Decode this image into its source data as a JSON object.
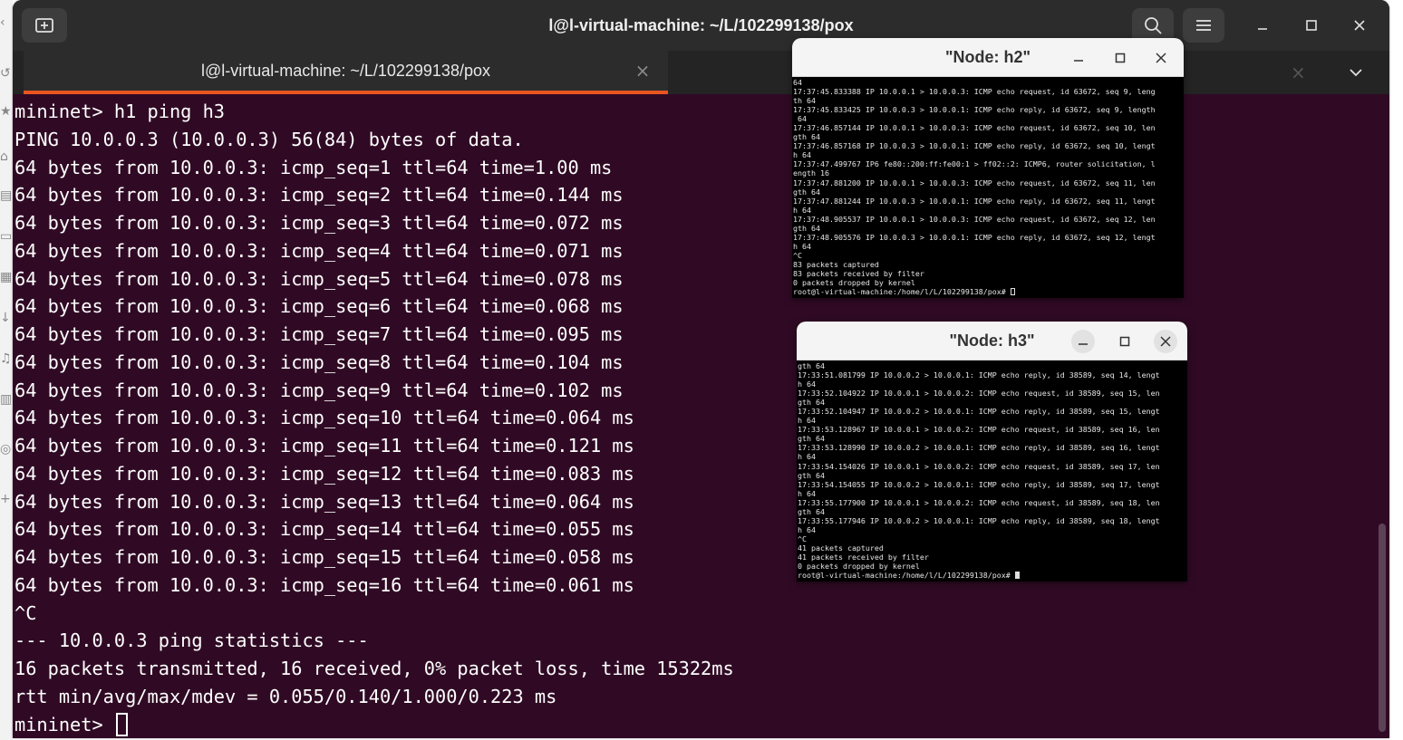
{
  "main_window": {
    "title": "l@l-virtual-machine: ~/L/102299138/pox",
    "tab_label": "l@l-virtual-machine: ~/L/102299138/pox",
    "terminal_lines": [
      "mininet> h1 ping h3",
      "PING 10.0.0.3 (10.0.0.3) 56(84) bytes of data.",
      "64 bytes from 10.0.0.3: icmp_seq=1 ttl=64 time=1.00 ms",
      "64 bytes from 10.0.0.3: icmp_seq=2 ttl=64 time=0.144 ms",
      "64 bytes from 10.0.0.3: icmp_seq=3 ttl=64 time=0.072 ms",
      "64 bytes from 10.0.0.3: icmp_seq=4 ttl=64 time=0.071 ms",
      "64 bytes from 10.0.0.3: icmp_seq=5 ttl=64 time=0.078 ms",
      "64 bytes from 10.0.0.3: icmp_seq=6 ttl=64 time=0.068 ms",
      "64 bytes from 10.0.0.3: icmp_seq=7 ttl=64 time=0.095 ms",
      "64 bytes from 10.0.0.3: icmp_seq=8 ttl=64 time=0.104 ms",
      "64 bytes from 10.0.0.3: icmp_seq=9 ttl=64 time=0.102 ms",
      "64 bytes from 10.0.0.3: icmp_seq=10 ttl=64 time=0.064 ms",
      "64 bytes from 10.0.0.3: icmp_seq=11 ttl=64 time=0.121 ms",
      "64 bytes from 10.0.0.3: icmp_seq=12 ttl=64 time=0.083 ms",
      "64 bytes from 10.0.0.3: icmp_seq=13 ttl=64 time=0.064 ms",
      "64 bytes from 10.0.0.3: icmp_seq=14 ttl=64 time=0.055 ms",
      "64 bytes from 10.0.0.3: icmp_seq=15 ttl=64 time=0.058 ms",
      "64 bytes from 10.0.0.3: icmp_seq=16 ttl=64 time=0.061 ms",
      "^C",
      "--- 10.0.0.3 ping statistics ---",
      "16 packets transmitted, 16 received, 0% packet loss, time 15322ms",
      "rtt min/avg/max/mdev = 0.055/0.140/1.000/0.223 ms"
    ],
    "prompt": "mininet> "
  },
  "node_h2": {
    "title": "\"Node: h2\"",
    "lines": [
      "64",
      "17:37:45.833388 IP 10.0.0.1 > 10.0.0.3: ICMP echo request, id 63672, seq 9, leng",
      "th 64",
      "17:37:45.833425 IP 10.0.0.3 > 10.0.0.1: ICMP echo reply, id 63672, seq 9, length",
      " 64",
      "17:37:46.857144 IP 10.0.0.1 > 10.0.0.3: ICMP echo request, id 63672, seq 10, len",
      "gth 64",
      "17:37:46.857168 IP 10.0.0.3 > 10.0.0.1: ICMP echo reply, id 63672, seq 10, lengt",
      "h 64",
      "17:37:47.499767 IP6 fe80::200:ff:fe00:1 > ff02::2: ICMP6, router solicitation, l",
      "ength 16",
      "17:37:47.881200 IP 10.0.0.1 > 10.0.0.3: ICMP echo request, id 63672, seq 11, len",
      "gth 64",
      "17:37:47.881244 IP 10.0.0.3 > 10.0.0.1: ICMP echo reply, id 63672, seq 11, lengt",
      "h 64",
      "17:37:48.905537 IP 10.0.0.1 > 10.0.0.3: ICMP echo request, id 63672, seq 12, len",
      "gth 64",
      "17:37:48.905576 IP 10.0.0.3 > 10.0.0.1: ICMP echo reply, id 63672, seq 12, lengt",
      "h 64",
      "^C",
      "83 packets captured",
      "83 packets received by filter",
      "0 packets dropped by kernel"
    ],
    "prompt": "root@l-virtual-machine:/home/l/L/102299138/pox# "
  },
  "node_h3": {
    "title": "\"Node: h3\"",
    "lines": [
      "gth 64",
      "17:33:51.081799 IP 10.0.0.2 > 10.0.0.1: ICMP echo reply, id 38589, seq 14, lengt",
      "h 64",
      "17:33:52.104922 IP 10.0.0.1 > 10.0.0.2: ICMP echo request, id 38589, seq 15, len",
      "gth 64",
      "17:33:52.104947 IP 10.0.0.2 > 10.0.0.1: ICMP echo reply, id 38589, seq 15, lengt",
      "h 64",
      "17:33:53.128967 IP 10.0.0.1 > 10.0.0.2: ICMP echo request, id 38589, seq 16, len",
      "gth 64",
      "17:33:53.128990 IP 10.0.0.2 > 10.0.0.1: ICMP echo reply, id 38589, seq 16, lengt",
      "h 64",
      "17:33:54.154026 IP 10.0.0.1 > 10.0.0.2: ICMP echo request, id 38589, seq 17, len",
      "gth 64",
      "17:33:54.154055 IP 10.0.0.2 > 10.0.0.1: ICMP echo reply, id 38589, seq 17, lengt",
      "h 64",
      "17:33:55.177900 IP 10.0.0.1 > 10.0.0.2: ICMP echo request, id 38589, seq 18, len",
      "gth 64",
      "17:33:55.177946 IP 10.0.0.2 > 10.0.0.1: ICMP echo reply, id 38589, seq 18, lengt",
      "h 64",
      "^C",
      "41 packets captured",
      "41 packets received by filter",
      "0 packets dropped by kernel"
    ],
    "prompt": "root@l-virtual-machine:/home/l/L/102299138/pox# "
  },
  "colors": {
    "terminal_bg": "#300a24",
    "titlebar_bg": "#2c2c2c",
    "tab_accent": "#e95420",
    "node_bg": "#000000"
  },
  "icons": {
    "new_tab": "new-tab-icon",
    "search": "search-icon",
    "menu": "hamburger-menu-icon",
    "minimize": "minimize-icon",
    "maximize": "maximize-icon",
    "close": "close-icon",
    "tab_dropdown": "chevron-down-icon"
  }
}
